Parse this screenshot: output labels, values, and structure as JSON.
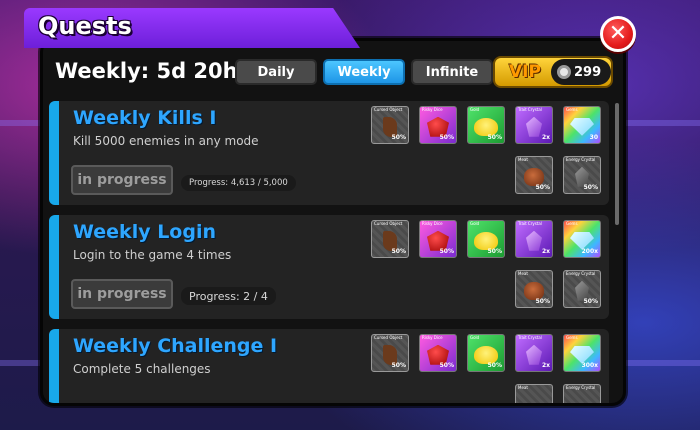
{
  "window": {
    "title": "Quests",
    "close_icon": "close-icon"
  },
  "header": {
    "timer": "Weekly: 5d 20h",
    "tabs": [
      {
        "label": "Daily",
        "active": false
      },
      {
        "label": "Weekly",
        "active": true
      },
      {
        "label": "Infinite",
        "active": false
      }
    ],
    "vip_label": "VIP",
    "coin_count": "299"
  },
  "quests": [
    {
      "title": "Weekly Kills I",
      "desc": "Kill 5000 enemies in any mode",
      "status_label": "in progress",
      "progress": "Progress: 4,613 / 5,000",
      "rewards": [
        {
          "name": "Cursed Object",
          "amount": "50%"
        },
        {
          "name": "Risky Dice",
          "amount": "50%"
        },
        {
          "name": "Gold",
          "amount": "50%"
        },
        {
          "name": "Trait Crystal",
          "amount": "2x"
        },
        {
          "name": "Gems",
          "amount": "30"
        },
        {
          "name": "Meat",
          "amount": "50%"
        },
        {
          "name": "Energy Crystal",
          "amount": "50%"
        }
      ]
    },
    {
      "title": "Weekly Login",
      "desc": "Login to the game 4 times",
      "status_label": "in progress",
      "progress": "Progress: 2 / 4",
      "rewards": [
        {
          "name": "Cursed Object",
          "amount": "50%"
        },
        {
          "name": "Risky Dice",
          "amount": "50%"
        },
        {
          "name": "Gold",
          "amount": "50%"
        },
        {
          "name": "Trait Crystal",
          "amount": "2x"
        },
        {
          "name": "Gems",
          "amount": "200x"
        },
        {
          "name": "Meat",
          "amount": "50%"
        },
        {
          "name": "Energy Crystal",
          "amount": "50%"
        }
      ]
    },
    {
      "title": "Weekly Challenge I",
      "desc": "Complete 5 challenges",
      "status_label": "",
      "progress": "",
      "rewards": [
        {
          "name": "Cursed Object",
          "amount": "50%"
        },
        {
          "name": "Risky Dice",
          "amount": "50%"
        },
        {
          "name": "Gold",
          "amount": "50%"
        },
        {
          "name": "Trait Crystal",
          "amount": "2x"
        },
        {
          "name": "Gems",
          "amount": "300x"
        },
        {
          "name": "Meat",
          "amount": ""
        },
        {
          "name": "Energy Crystal",
          "amount": ""
        }
      ]
    }
  ],
  "colors": {
    "title_tab": "#7b25e6",
    "tab_active": "#2aa8f2",
    "quest_accent": "#18a8ea",
    "quest_title": "#2ea6ff",
    "vip_gold": "#f2b400",
    "close_red": "#e41b1b"
  }
}
